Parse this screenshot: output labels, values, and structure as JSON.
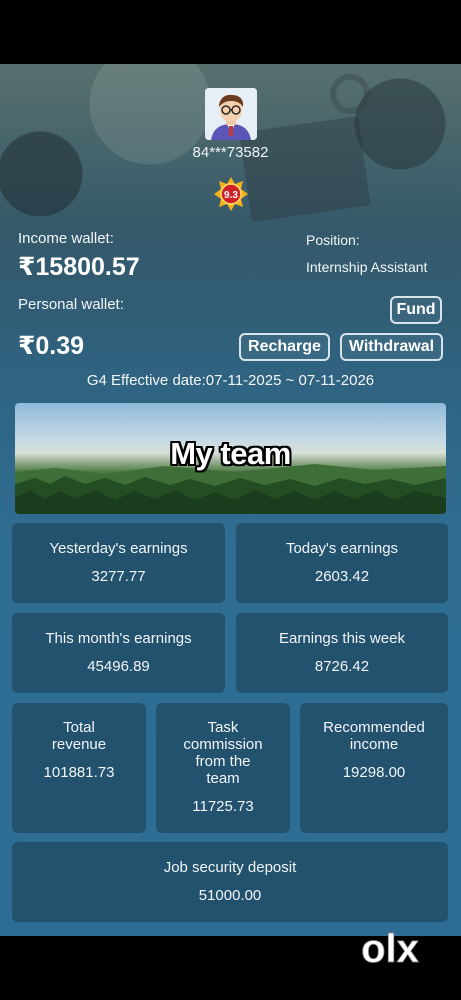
{
  "profile": {
    "user_id": "84***73582",
    "level": "9.3"
  },
  "wallet": {
    "income_label": "Income wallet:",
    "income_amount": "₹15800.57",
    "position_label": "Position:",
    "position_value": "Internship Assistant",
    "personal_label": "Personal wallet:",
    "personal_amount": "₹0.39",
    "fund_label": "Fund",
    "recharge_label": "Recharge",
    "withdrawal_label": "Withdrawal",
    "effective_dates": "G4   Effective date:07-11-2025 ~ 07-11-2026"
  },
  "banner": {
    "title": "My team"
  },
  "stats": {
    "yesterday": {
      "title": "Yesterday's earnings",
      "value": "3277.77"
    },
    "today": {
      "title": "Today's earnings",
      "value": "2603.42"
    },
    "month": {
      "title": "This month's earnings",
      "value": "45496.89"
    },
    "week": {
      "title": "Earnings this week",
      "value": "8726.42"
    },
    "total_revenue": {
      "title_1": "Total",
      "title_2": "revenue",
      "value": "101881.73"
    },
    "task_commission": {
      "title_1": "Task",
      "title_2": "commission",
      "title_3": "from the",
      "title_4": "team",
      "value": "11725.73"
    },
    "recommended": {
      "title_1": "Recommended",
      "title_2": "income",
      "value": "19298.00"
    },
    "deposit": {
      "title": "Job security deposit",
      "value": "51000.00"
    }
  },
  "watermark": {
    "text": "olx"
  },
  "colors": {
    "card_bg": "#23526e",
    "badge_red": "#d2202a",
    "badge_gold": "#f2b21c"
  }
}
